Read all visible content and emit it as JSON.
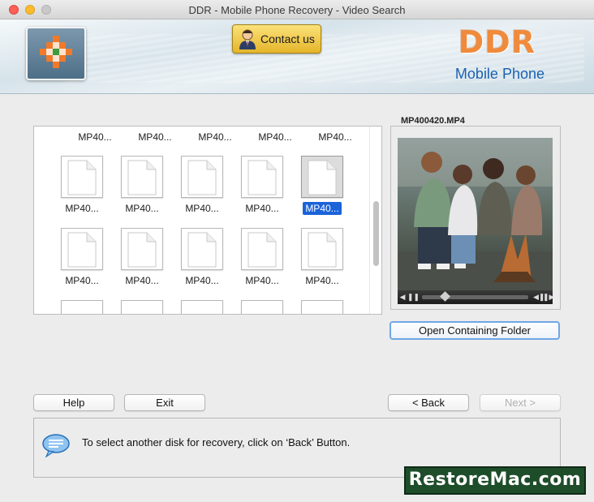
{
  "window": {
    "title": "DDR - Mobile Phone Recovery - Video Search"
  },
  "header": {
    "contact_label": "Contact us",
    "brand_title": "DDR",
    "brand_subtitle": "Mobile Phone"
  },
  "thumbnails": {
    "row0_labels": [
      "MP40...",
      "MP40...",
      "MP40...",
      "MP40...",
      "MP40..."
    ],
    "row1_labels": [
      "MP40...",
      "MP40...",
      "MP40...",
      "MP40...",
      "MP40..."
    ],
    "row2_labels": [
      "MP40...",
      "MP40...",
      "MP40...",
      "MP40...",
      "MP40..."
    ],
    "selected_index": 4
  },
  "preview": {
    "filename": "MP400420.MP4",
    "open_folder_label": "Open Containing Folder"
  },
  "buttons": {
    "help": "Help",
    "exit": "Exit",
    "back": "< Back",
    "next": "Next >"
  },
  "message": {
    "text": "To select another disk for recovery, click on ‘Back’ Button."
  },
  "watermark": "RestoreMac.com",
  "colors": {
    "brand_orange": "#f08a3c",
    "brand_blue": "#1b62b0",
    "selection": "#1a63d9"
  }
}
